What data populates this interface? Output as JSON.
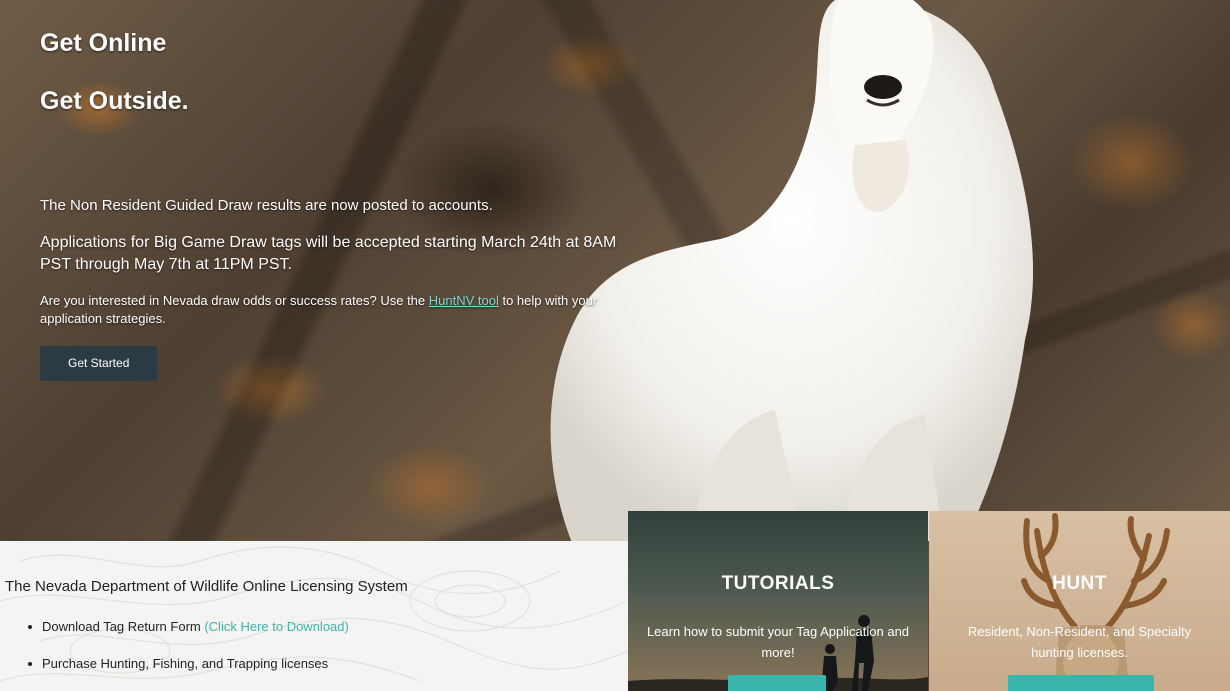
{
  "hero": {
    "title_line1": "Get Online",
    "title_line2": "Get Outside.",
    "notice1": "The Non Resident Guided Draw results are now posted to accounts.",
    "notice2": "Applications for Big Game Draw tags will be accepted starting March 24th at 8AM PST through May 7th at 11PM PST.",
    "notice3_before": "Are you interested in Nevada draw odds or success rates? Use the ",
    "notice3_link": "HuntNV tool",
    "notice3_after": " to help with your application strategies.",
    "cta_label": "Get Started"
  },
  "info": {
    "title": "The Nevada Department of Wildlife Online Licensing System",
    "items": [
      {
        "text": "Download Tag Return Form ",
        "link": "(Click Here to Download)"
      },
      {
        "text": "Purchase Hunting, Fishing, and Trapping licenses",
        "link": ""
      }
    ]
  },
  "cards": [
    {
      "title": "TUTORIALS",
      "desc": "Learn how to submit your Tag Application and more!",
      "button": ""
    },
    {
      "title": "HUNT",
      "desc": "Resident, Non-Resident, and Specialty hunting licenses.",
      "button": ""
    }
  ],
  "colors": {
    "accent": "#3ab5ab",
    "link": "#7fd8d2",
    "cta": "#2c3a44"
  },
  "icons": [
    "mountain-goat-photo",
    "deer-antlers-image",
    "hikers-silhouette-image",
    "topo-map-pattern"
  ]
}
